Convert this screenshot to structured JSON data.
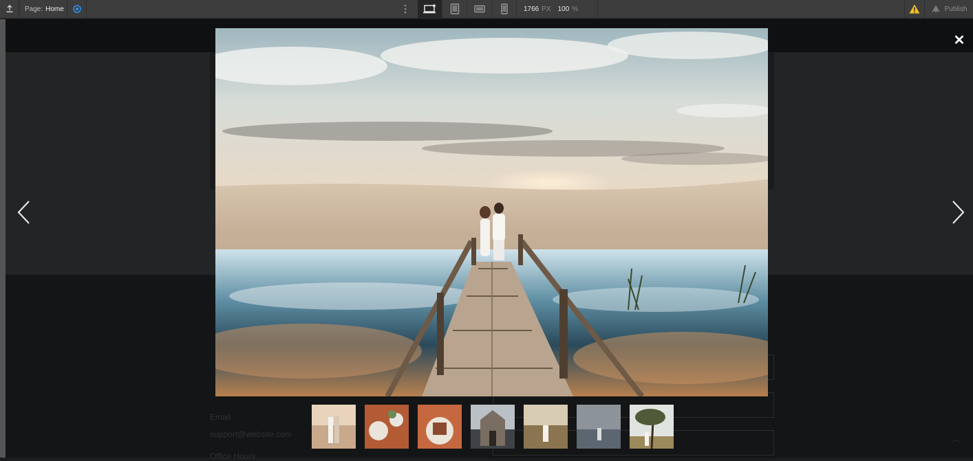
{
  "toolbar": {
    "page_label": "Page:",
    "page_name": "Home",
    "canvas_width": "1766",
    "width_unit": "PX",
    "zoom": "100",
    "zoom_unit": "%",
    "publish_label": "Publish",
    "active_device": "desktop"
  },
  "background_page": {
    "email_label": "Email",
    "email_value": "support@website.com",
    "office_hours_label": "Office Hours"
  },
  "lightbox": {
    "close_glyph": "✕",
    "thumbnail_count": 7,
    "active_index": 0
  },
  "colors": {
    "toolbar_bg": "#3d3d3d",
    "preview_accent": "#2b8ff0",
    "warning": "#f3c023"
  }
}
